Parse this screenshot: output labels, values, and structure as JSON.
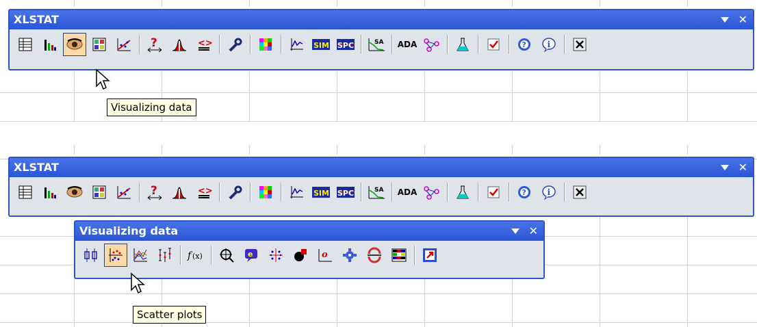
{
  "main_toolbar": {
    "title": "XLSTAT",
    "minimize_glyph": "▼",
    "close_glyph": "✕",
    "buttons": [
      {
        "name": "data-table-icon"
      },
      {
        "name": "bar-chart-icon"
      },
      {
        "name": "eye-icon"
      },
      {
        "name": "grid-icon"
      },
      {
        "name": "scatter-line-icon"
      },
      {
        "name": "question-arrows-icon"
      },
      {
        "name": "bell-curve-icon"
      },
      {
        "name": "compare-icon"
      },
      {
        "name": "wrench-icon"
      },
      {
        "name": "color-squares-icon"
      },
      {
        "name": "time-series-icon"
      },
      {
        "name": "sim-icon",
        "text": "SIM"
      },
      {
        "name": "spc-icon",
        "text": "SPC"
      },
      {
        "name": "sensory-icon",
        "text": "SA"
      },
      {
        "name": "ada-icon",
        "text": "ADA"
      },
      {
        "name": "network-icon"
      },
      {
        "name": "flask-icon"
      },
      {
        "name": "checkbox-icon"
      },
      {
        "name": "help-icon"
      },
      {
        "name": "info-icon"
      },
      {
        "name": "close-box-icon"
      }
    ]
  },
  "tooltip_top": "Visualizing data",
  "sub_toolbar": {
    "title": "Visualizing data",
    "minimize_glyph": "▼",
    "close_glyph": "✕"
  },
  "tooltip_bottom": "Scatter plots",
  "colors": {
    "title_blue": "#2a55d4",
    "toolbar_bg": "#dfe3ea",
    "active_bg": "#fbd9a8",
    "tooltip_bg": "#ffffe1"
  }
}
